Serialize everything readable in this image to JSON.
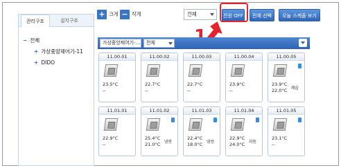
{
  "left_panel": {
    "tabs": [
      {
        "label": "관리구조"
      },
      {
        "label": "설치구조"
      }
    ],
    "tree": [
      {
        "label": "전체",
        "toggle": "−",
        "level": 1
      },
      {
        "label": "가상중앙제어기-11",
        "toggle": "+",
        "level": 2
      },
      {
        "label": "DIDO",
        "toggle": "+",
        "level": 2
      }
    ]
  },
  "toolbar": {
    "zoom_in_label": "크게",
    "zoom_out_label": "작게",
    "select_value": "전체",
    "buttons": [
      {
        "label": "전원 OFF"
      },
      {
        "label": "전체 선택"
      },
      {
        "label": "오늘 스케쥴 보기"
      }
    ]
  },
  "callout": {
    "number": "1"
  },
  "filter": {
    "group_select": "가상중앙제어기-...",
    "type_select": "전체"
  },
  "devices": [
    {
      "id": "11.00.01",
      "temp1": "23.5°C",
      "temp2": "--",
      "mode": "",
      "badge": false
    },
    {
      "id": "11.00.02",
      "temp1": "22.7°C",
      "temp2": "--",
      "mode": "",
      "badge": false
    },
    {
      "id": "11.00.03",
      "temp1": "22.7°C",
      "temp2": "--",
      "mode": "",
      "badge": false
    },
    {
      "id": "11.00.04",
      "temp1": "23.9°C",
      "temp2": "--",
      "mode": "",
      "badge": false
    },
    {
      "id": "11.00.05",
      "temp1": "23.9°C",
      "temp2": "22.0°C",
      "mode": "제습",
      "badge": true
    },
    {
      "id": "11.01.01",
      "temp1": "22.9°C",
      "temp2": "--",
      "mode": "",
      "badge": false
    },
    {
      "id": "11.01.02",
      "temp1": "25.4°C",
      "temp2": "21.0°C",
      "mode": "냉방",
      "badge": true
    },
    {
      "id": "11.01.03",
      "temp1": "22.4°C",
      "temp2": "18.0°C",
      "mode": "냉방",
      "badge": true
    },
    {
      "id": "11.01.04",
      "temp1": "22.9°C",
      "temp2": "24.0°C",
      "mode": "자동",
      "badge": true
    },
    {
      "id": "11.01.05",
      "temp1": "23.1°C",
      "temp2": "--",
      "mode": "",
      "badge": true
    }
  ],
  "colors": {
    "accent": "#2f63b3",
    "highlight": "#e3242b"
  }
}
